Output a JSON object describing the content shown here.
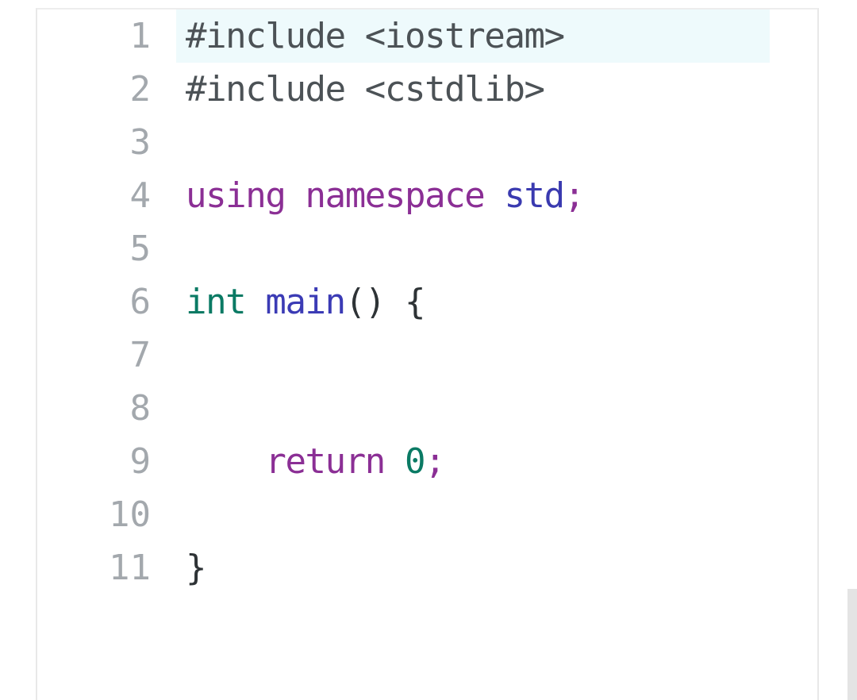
{
  "editor": {
    "language": "C++",
    "highlighted_line": 1,
    "gutter_color": "#a3a8ad",
    "highlight_color": "#eefafc",
    "panel_border_color": "#e8e8e8",
    "scrollbar_color": "#e4e4e4",
    "lines": [
      {
        "number": "1",
        "highlighted": true,
        "tokens": [
          {
            "text": "#include <iostream>",
            "type": "plain"
          }
        ]
      },
      {
        "number": "2",
        "highlighted": false,
        "tokens": [
          {
            "text": "#include <cstdlib>",
            "type": "plain"
          }
        ]
      },
      {
        "number": "3",
        "highlighted": false,
        "tokens": []
      },
      {
        "number": "4",
        "highlighted": false,
        "tokens": [
          {
            "text": "using namespace ",
            "type": "keyword"
          },
          {
            "text": "std",
            "type": "ns"
          },
          {
            "text": ";",
            "type": "keyword"
          }
        ]
      },
      {
        "number": "5",
        "highlighted": false,
        "tokens": []
      },
      {
        "number": "6",
        "highlighted": false,
        "tokens": [
          {
            "text": "int ",
            "type": "type"
          },
          {
            "text": "main",
            "type": "name"
          },
          {
            "text": "() {",
            "type": "punct"
          }
        ]
      },
      {
        "number": "7",
        "highlighted": false,
        "tokens": []
      },
      {
        "number": "8",
        "highlighted": false,
        "tokens": []
      },
      {
        "number": "9",
        "highlighted": false,
        "tokens": [
          {
            "text": "    return ",
            "type": "keyword"
          },
          {
            "text": "0",
            "type": "number"
          },
          {
            "text": ";",
            "type": "keyword"
          }
        ]
      },
      {
        "number": "10",
        "highlighted": false,
        "tokens": []
      },
      {
        "number": "11",
        "highlighted": false,
        "tokens": [
          {
            "text": "}",
            "type": "punct"
          }
        ]
      }
    ]
  },
  "scrollbar": {
    "thumb_label": "vertical-scroll-thumb"
  }
}
